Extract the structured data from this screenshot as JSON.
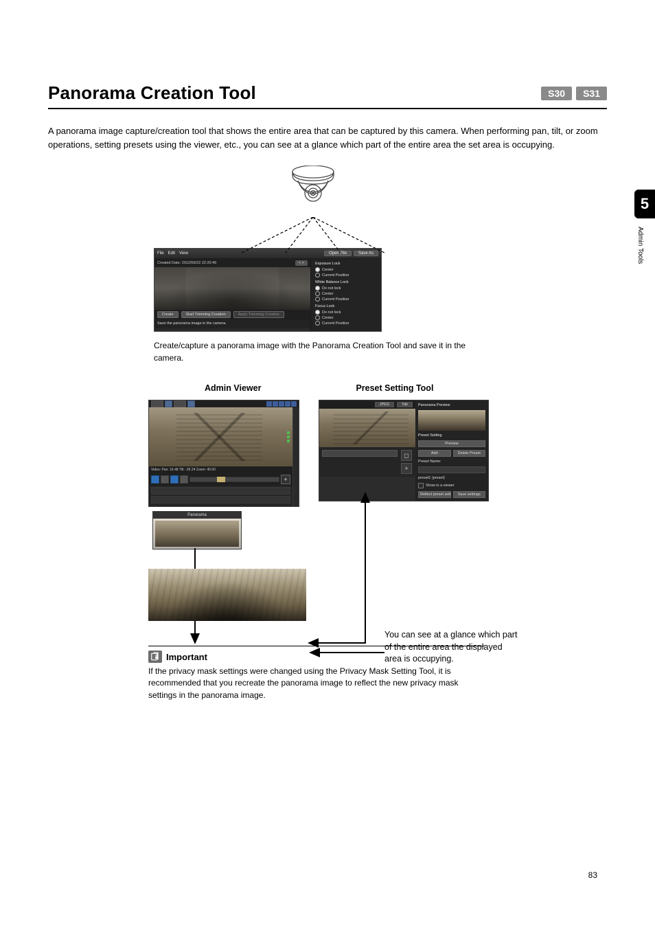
{
  "title": "Panorama Creation Tool",
  "badges": [
    "S30",
    "S31"
  ],
  "intro": "A panorama image capture/creation tool that shows the entire area that can be captured by this camera. When performing pan, tilt, or zoom operations, setting presets using the viewer, etc., you can see at a glance which part of the entire area the set area is occupying.",
  "pano_tool": {
    "menu": {
      "file": "File",
      "edit": "Edit",
      "view": "View"
    },
    "toolbar": {
      "open": "Open File",
      "save": "Save As"
    },
    "header": {
      "created": "Created Date: 2012/06/22 22:20:49",
      "nav": "<  >"
    },
    "footer": {
      "create": "Create",
      "start_trim": "Start Trimming Creation",
      "apply": "Apply Trimming Creation"
    },
    "save_line": "Save the panorama image in the camera.",
    "right": {
      "exposure": {
        "title": "Exposure Lock",
        "center": "Center",
        "current": "Current Position"
      },
      "wb": {
        "title": "White Balance Lock",
        "nolock": "Do not lock",
        "center": "Center",
        "current": "Current Position"
      },
      "focus": {
        "title": "Focus Lock",
        "nolock": "Do not lock",
        "center": "Center",
        "current": "Current Position"
      }
    }
  },
  "caption": "Create/capture a panorama image with the Panorama Creation Tool and save it in the camera.",
  "viewers": {
    "admin_label": "Admin Viewer",
    "preset_label": "Preset Setting Tool"
  },
  "admin_viewer": {
    "status": "Video: Pan: 16.48 Tilt: -26.24 Zoom: 40.00",
    "panorama_title": "Panorama"
  },
  "preset_tool": {
    "tabs": {
      "t1": "JPEG",
      "t2": "Tab"
    },
    "side": {
      "title": "Panorama Preview",
      "preset_label": "Preset Setting",
      "preview": "Preview",
      "add": "Add",
      "del": "Delete Preset",
      "name_label": "Preset Name:",
      "name": "preset1 (preset)",
      "chk": "Show in a viewer",
      "reflect": "Reflect preset settings",
      "save": "Save settings"
    }
  },
  "glance": "You can see at a glance which part of the entire area the displayed area is occupying.",
  "important": {
    "label": "Important",
    "text": "If the privacy mask settings were changed using the Privacy Mask Setting Tool, it is recommended that you recreate the panorama image to reflect the new privacy mask settings in the panorama image."
  },
  "chapter_num": "5",
  "chapter_label": "Admin Tools",
  "page_num": "83"
}
